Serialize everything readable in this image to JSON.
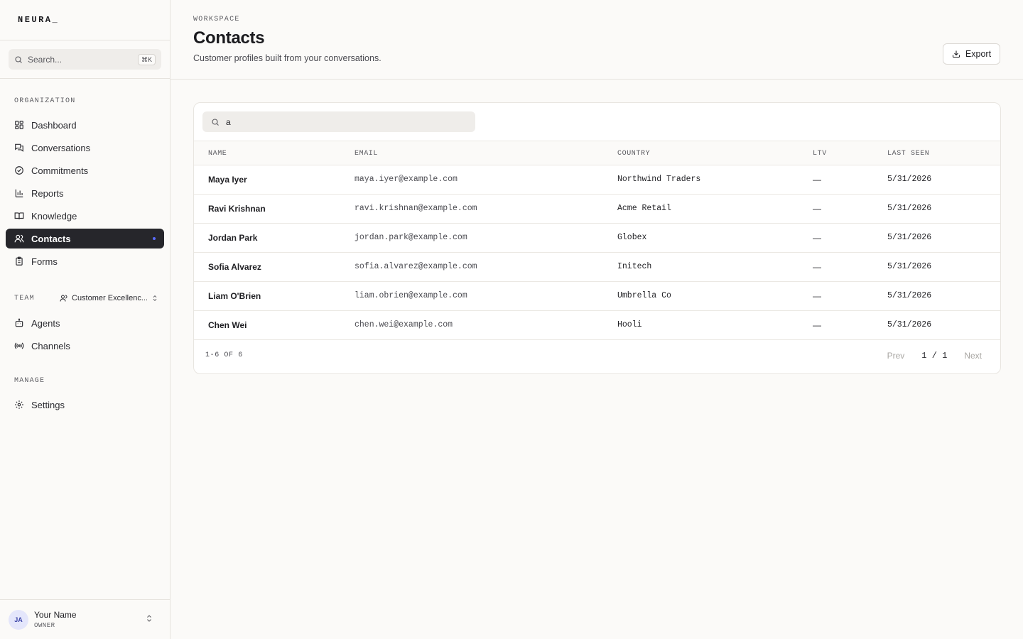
{
  "brand": "NEURA_",
  "sidebar": {
    "search_placeholder": "Search...",
    "search_shortcut": "⌘K",
    "org_label": "ORGANIZATION",
    "items": [
      {
        "label": "Dashboard",
        "icon": "dashboard-icon"
      },
      {
        "label": "Conversations",
        "icon": "conversations-icon"
      },
      {
        "label": "Commitments",
        "icon": "commitments-icon"
      },
      {
        "label": "Reports",
        "icon": "reports-icon"
      },
      {
        "label": "Knowledge",
        "icon": "knowledge-icon"
      },
      {
        "label": "Contacts",
        "icon": "contacts-icon",
        "active": true
      },
      {
        "label": "Forms",
        "icon": "forms-icon"
      }
    ],
    "team_label": "TEAM",
    "team_selected": "Customer Excellenc...",
    "team_items": [
      {
        "label": "Agents",
        "icon": "agents-icon"
      },
      {
        "label": "Channels",
        "icon": "channels-icon"
      }
    ],
    "manage_label": "MANAGE",
    "manage_items": [
      {
        "label": "Settings",
        "icon": "gear-icon"
      }
    ],
    "user": {
      "initials": "JA",
      "name": "Your Name",
      "role": "OWNER"
    }
  },
  "header": {
    "eyebrow": "WORKSPACE",
    "title": "Contacts",
    "subtitle": "Customer profiles built from your conversations.",
    "export_label": "Export"
  },
  "table": {
    "filter_value": "a",
    "columns": [
      "NAME",
      "EMAIL",
      "COUNTRY",
      "LTV",
      "LAST SEEN"
    ],
    "rows": [
      {
        "name": "Maya Iyer",
        "email": "maya.iyer@example.com",
        "country": "Northwind Traders",
        "ltv": "—",
        "last_seen": "5/31/2026"
      },
      {
        "name": "Ravi Krishnan",
        "email": "ravi.krishnan@example.com",
        "country": "Acme Retail",
        "ltv": "—",
        "last_seen": "5/31/2026"
      },
      {
        "name": "Jordan Park",
        "email": "jordan.park@example.com",
        "country": "Globex",
        "ltv": "—",
        "last_seen": "5/31/2026"
      },
      {
        "name": "Sofia Alvarez",
        "email": "sofia.alvarez@example.com",
        "country": "Initech",
        "ltv": "—",
        "last_seen": "5/31/2026"
      },
      {
        "name": "Liam O'Brien",
        "email": "liam.obrien@example.com",
        "country": "Umbrella Co",
        "ltv": "—",
        "last_seen": "5/31/2026"
      },
      {
        "name": "Chen Wei",
        "email": "chen.wei@example.com",
        "country": "Hooli",
        "ltv": "—",
        "last_seen": "5/31/2026"
      }
    ],
    "count_text": "1-6 OF 6",
    "prev_label": "Prev",
    "page_text": "1 / 1",
    "next_label": "Next"
  },
  "colors": {
    "accent": "#5b6cff",
    "active_bg": "#26262b",
    "background": "#fbfaf8"
  }
}
